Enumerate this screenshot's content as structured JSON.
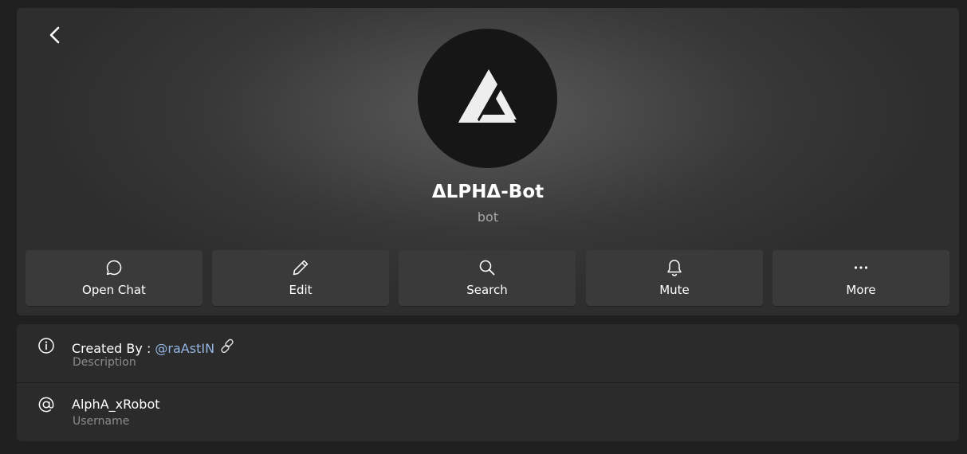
{
  "profile": {
    "name": "ΔLPHΔ-Bot",
    "subtitle": "bot",
    "avatar_icon": "delta-logo-icon"
  },
  "navigation": {
    "back_icon": "chevron-left-icon"
  },
  "actions": [
    {
      "label": "Open Chat",
      "icon": "chat-bubble-icon"
    },
    {
      "label": "Edit",
      "icon": "pencil-icon"
    },
    {
      "label": "Search",
      "icon": "search-icon"
    },
    {
      "label": "Mute",
      "icon": "bell-icon"
    },
    {
      "label": "More",
      "icon": "more-dots-icon"
    }
  ],
  "info": {
    "description": {
      "prefix": "Created By : ",
      "handle": "@raAstIN",
      "caption": "Description",
      "icon": "info-icon",
      "link_icon": "chain-link-icon"
    },
    "username": {
      "value": "AlphA_xRobot",
      "caption": "Username",
      "icon": "at-sign-icon"
    }
  },
  "colors": {
    "background": "#202020",
    "card": "#2b2b2b",
    "button": "#3a3a3a",
    "link": "#95b6e4",
    "caption": "#8c8c8c"
  }
}
